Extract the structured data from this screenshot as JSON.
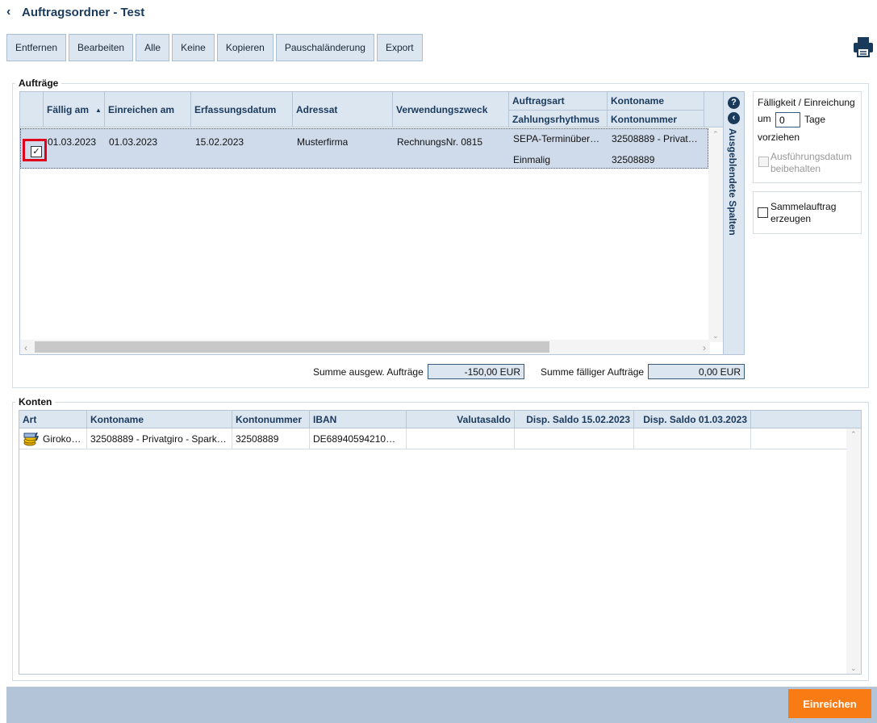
{
  "header": {
    "title": "Auftragsordner - Test"
  },
  "toolbar": {
    "remove": "Entfernen",
    "edit": "Bearbeiten",
    "all": "Alle",
    "none": "Keine",
    "copy": "Kopieren",
    "lump_change": "Pauschaländerung",
    "export": "Export"
  },
  "orders": {
    "legend": "Aufträge",
    "columns": {
      "due": "Fällig am",
      "submit": "Einreichen am",
      "entry": "Erfassungsdatum",
      "addressee": "Adressat",
      "purpose": "Verwendungszweck",
      "order_type": "Auftragsart",
      "rhythm": "Zahlungsrhythmus",
      "account_name": "Kontoname",
      "account_number": "Kontonummer"
    },
    "rows": [
      {
        "checked": true,
        "due": "01.03.2023",
        "submit": "01.03.2023",
        "entry": "15.02.2023",
        "addressee": "Musterfirma",
        "purpose": "RechnungsNr. 0815",
        "order_type": "SEPA-Terminüber…",
        "rhythm": "Einmalig",
        "account_name": "32508889 - Privat…",
        "account_number": "32508889"
      }
    ],
    "hidden_columns_label": "Ausgeblendete Spalten",
    "sum_selected_label": "Summe ausgew. Aufträge",
    "sum_selected_value": "-150,00 EUR",
    "sum_due_label": "Summe fälliger Aufträge",
    "sum_due_value": "0,00 EUR"
  },
  "options": {
    "due_title": "Fälligkeit / Einreichung",
    "um": "um",
    "days_value": "0",
    "tage": "Tage",
    "vorziehen": "vorziehen",
    "keep_date_line1": "Ausführungsdatum",
    "keep_date_line2": "beibehalten",
    "collective_line1": "Sammelauftrag",
    "collective_line2": "erzeugen"
  },
  "accounts": {
    "legend": "Konten",
    "columns": {
      "type": "Art",
      "name": "Kontoname",
      "number": "Kontonummer",
      "iban": "IBAN",
      "balance": "Valutasaldo",
      "disp1": "Disp. Saldo 15.02.2023",
      "disp2": "Disp. Saldo 01.03.2023"
    },
    "rows": [
      {
        "type": "Giroko…",
        "name": "32508889 - Privatgiro - Spark…",
        "number": "32508889",
        "iban": "DE68940594210…",
        "balance": "",
        "disp1": "",
        "disp2": ""
      }
    ]
  },
  "footer": {
    "submit": "Einreichen"
  },
  "colors": {
    "header_bg": "#dce6f1",
    "accent": "#1a3a5c",
    "submit": "#f97b14",
    "footer_bg": "#b3c4d8",
    "highlight_border": "#e0001b"
  }
}
